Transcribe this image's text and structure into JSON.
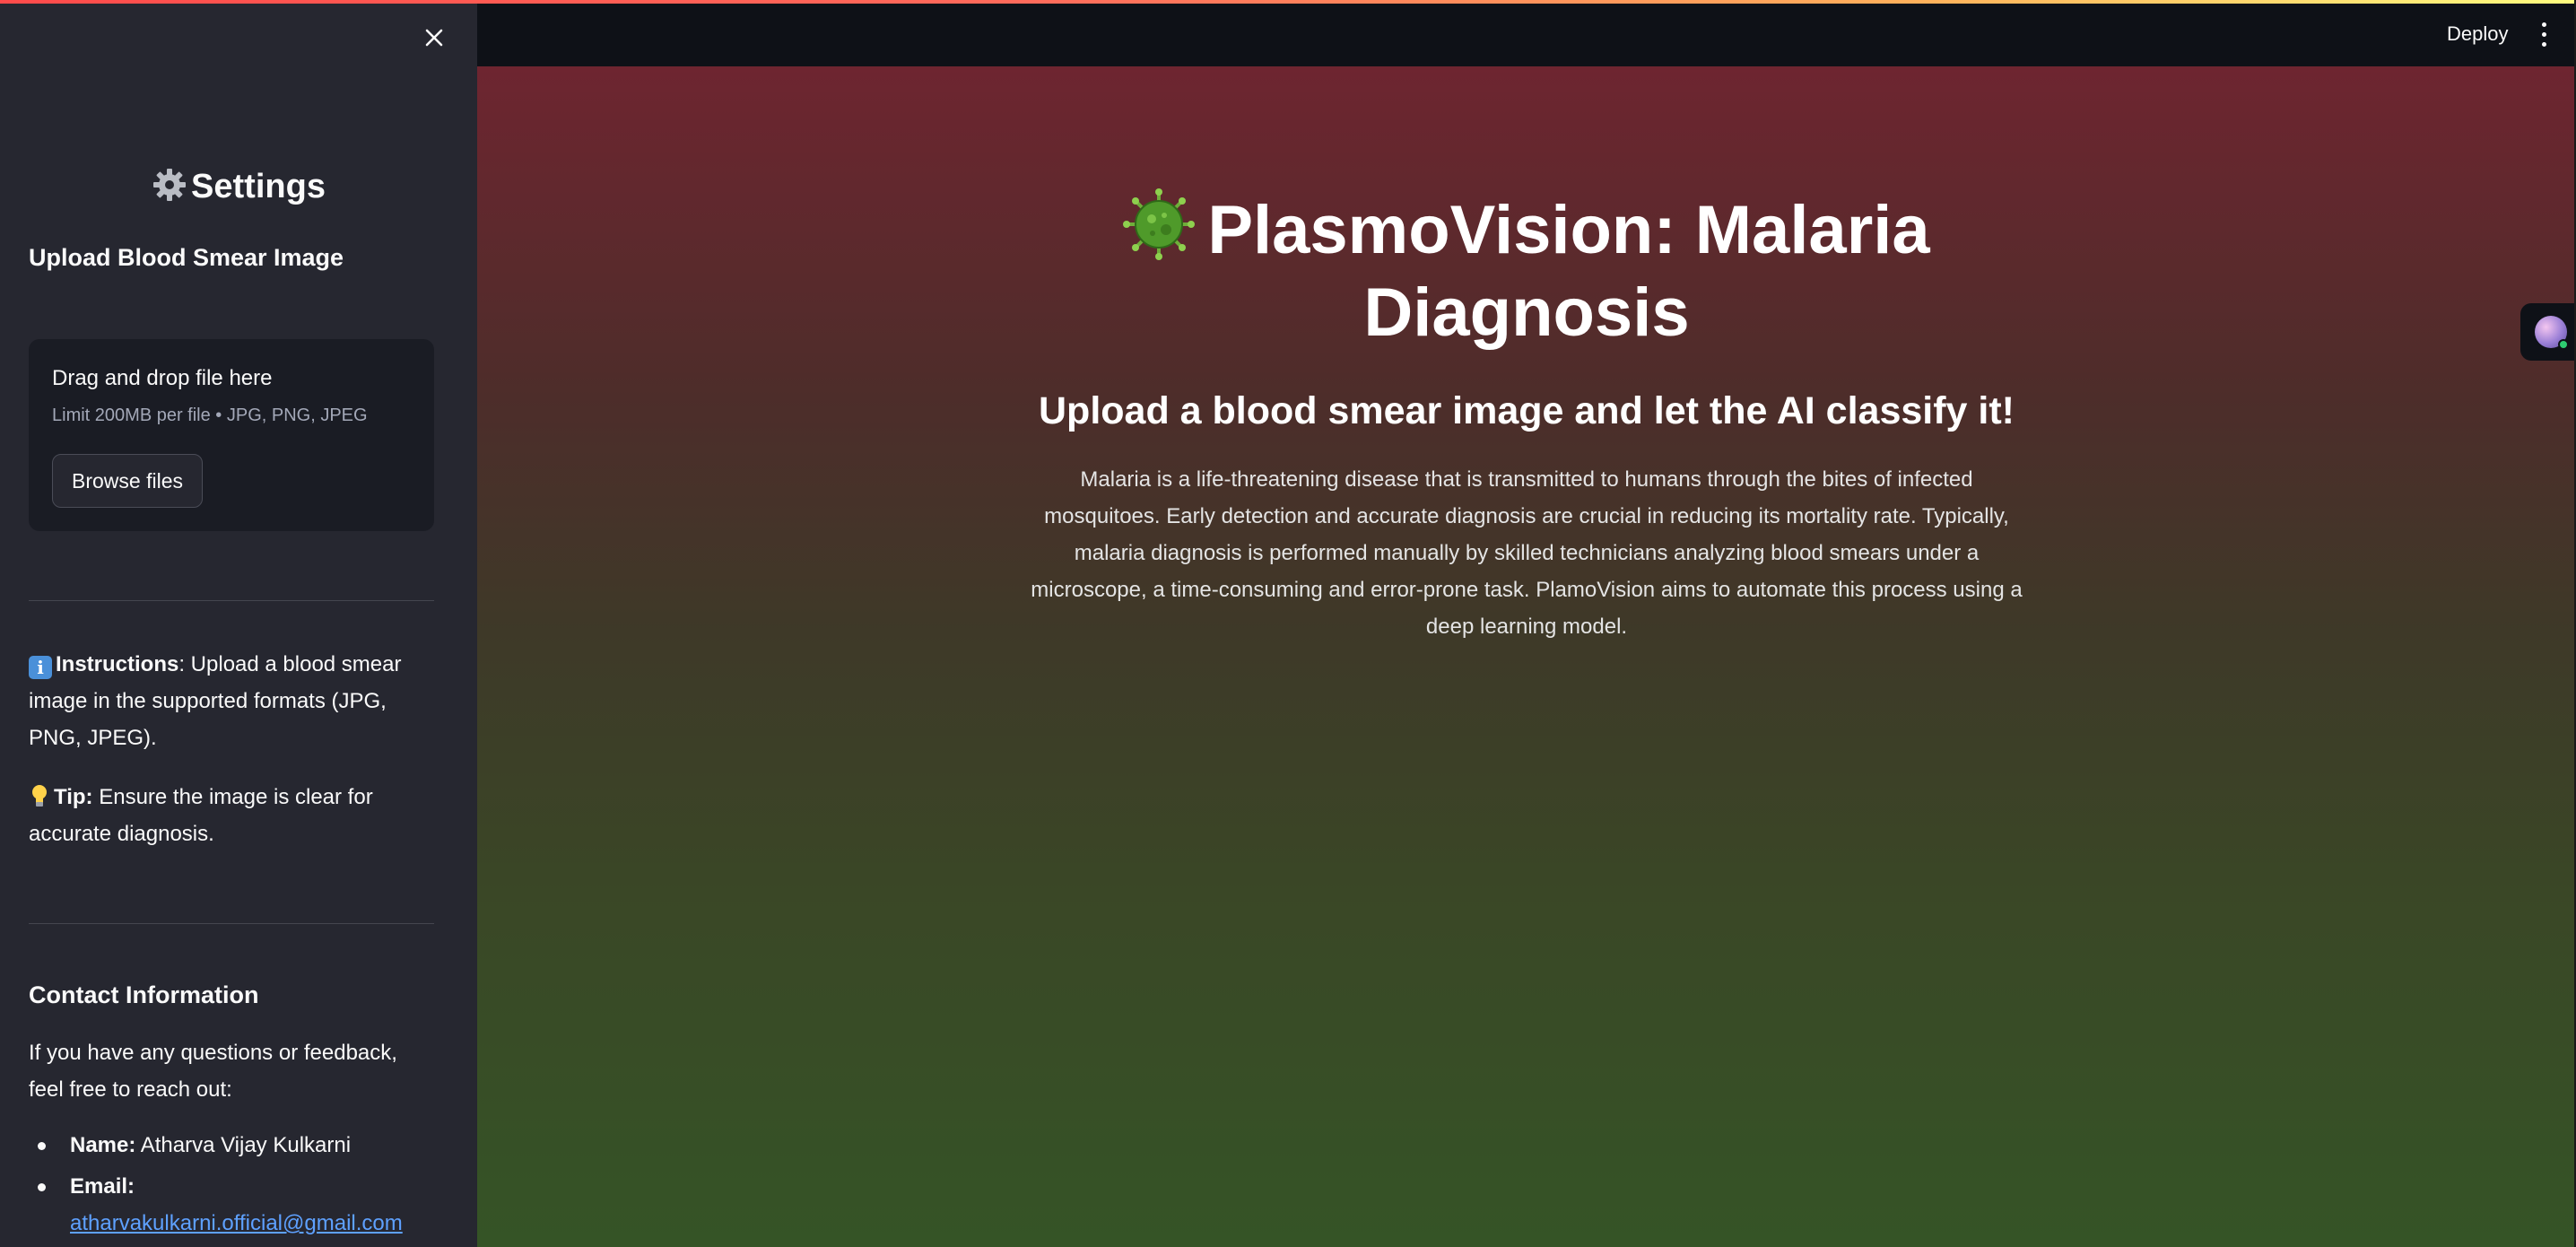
{
  "header": {
    "deploy_label": "Deploy",
    "menu_icon": "kebab-menu-icon"
  },
  "sidebar": {
    "close_icon": "close-icon",
    "title_icon": "gear-icon",
    "title": "Settings",
    "upload_label": "Upload Blood Smear Image",
    "uploader": {
      "drag_text": "Drag and drop file here",
      "limit_text": "Limit 200MB per file • JPG, PNG, JPEG",
      "browse_label": "Browse files"
    },
    "instructions": {
      "icon": "info-icon",
      "label": "Instructions",
      "text": ": Upload a blood smear image in the supported formats (JPG, PNG, JPEG)."
    },
    "tip": {
      "icon": "lightbulb-icon",
      "label": "Tip:",
      "text": " Ensure the image is clear for accurate diagnosis."
    },
    "contact": {
      "title": "Contact Information",
      "intro": "If you have any questions or feedback, feel free to reach out:",
      "name_label": "Name:",
      "name_value": " Atharva Vijay Kulkarni",
      "email_label": "Email:",
      "email_value": "atharvakulkarni.official@gmail.com"
    }
  },
  "main": {
    "title_icon": "microbe-icon",
    "title_line1": "PlasmoVision: Malaria",
    "title_line2": "Diagnosis",
    "subtitle": "Upload a blood smear image and let the AI classify it!",
    "description": "Malaria is a life-threatening disease that is transmitted to humans through the bites of infected mosquitoes. Early detection and accurate diagnosis are crucial in reducing its mortality rate. Typically, malaria diagnosis is performed manually by skilled technicians analyzing blood smears under a microscope, a time-consuming and error-prone task. PlamoVision aims to automate this process using a deep learning model."
  },
  "colors": {
    "sidebar_bg": "#262730",
    "header_bg": "#0e1117",
    "gradient_top": "#6e2530",
    "gradient_bottom": "#355426",
    "link": "#5ea1ff"
  }
}
